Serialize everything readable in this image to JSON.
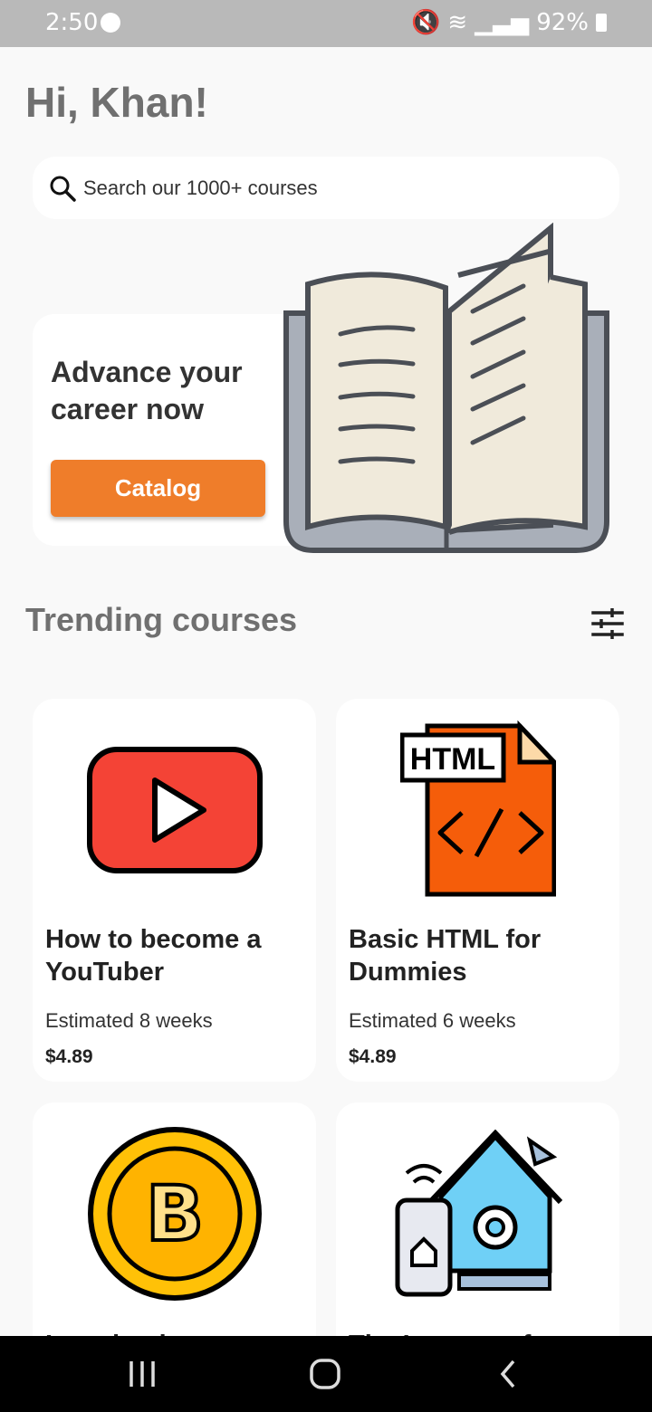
{
  "status": {
    "time": "2:50",
    "battery": "92%"
  },
  "greeting": "Hi, Khan!",
  "search": {
    "placeholder": "Search our 1000+ courses"
  },
  "promo": {
    "title": "Advance your career now",
    "button": "Catalog"
  },
  "section_title": "Trending courses",
  "courses": [
    {
      "title": "How to become a YouTuber",
      "estimate": "Estimated 8 weeks",
      "price": "$4.89",
      "icon": "youtube-icon"
    },
    {
      "title": "Basic HTML for Dummies",
      "estimate": "Estimated 6 weeks",
      "price": "$4.89",
      "icon": "html-file-icon"
    },
    {
      "title": "Introduction to ...",
      "icon": "bitcoin-icon"
    },
    {
      "title": "The Internet of ...",
      "icon": "smart-home-icon"
    }
  ],
  "colors": {
    "accent": "#ef7d2a",
    "statusbar": "#b9b9b9",
    "background": "#f9f9f9"
  }
}
